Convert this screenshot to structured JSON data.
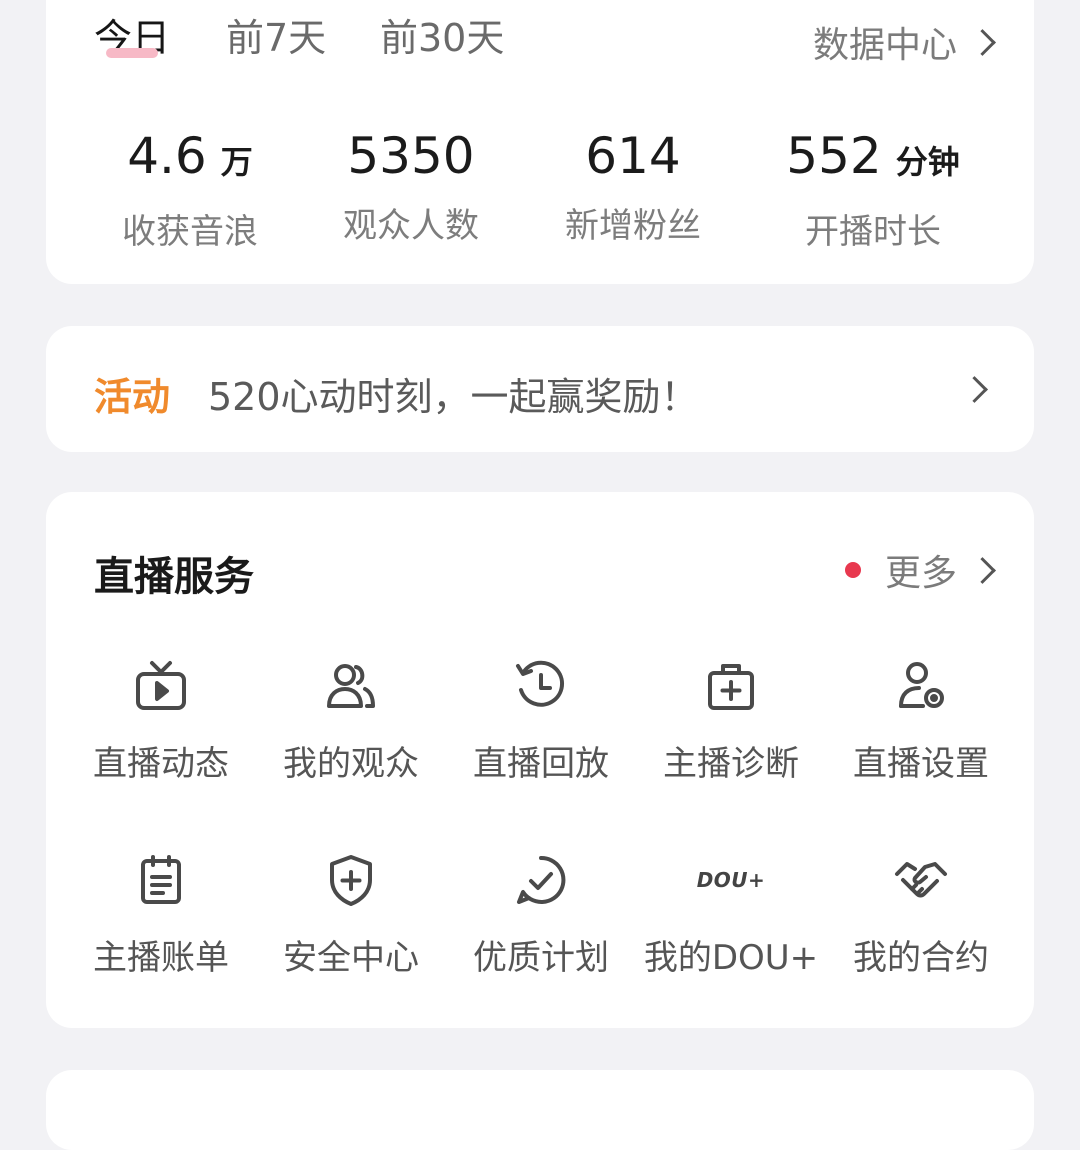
{
  "stats": {
    "tabs": [
      "今日",
      "前7天",
      "前30天"
    ],
    "data_center": "数据中心",
    "items": [
      {
        "value": "4.6",
        "unit": "万",
        "label": "收获音浪"
      },
      {
        "value": "5350",
        "unit": "",
        "label": "观众人数"
      },
      {
        "value": "614",
        "unit": "",
        "label": "新增粉丝"
      },
      {
        "value": "552",
        "unit": "分钟",
        "label": "开播时长"
      }
    ]
  },
  "activity": {
    "tag": "活动",
    "text": "520心动时刻，一起赢奖励！"
  },
  "services": {
    "title": "直播服务",
    "more": "更多",
    "items": [
      {
        "label": "直播动态",
        "icon": "tv-play-icon"
      },
      {
        "label": "我的观众",
        "icon": "audience-icon"
      },
      {
        "label": "直播回放",
        "icon": "history-clock-icon"
      },
      {
        "label": "主播诊断",
        "icon": "medical-kit-icon"
      },
      {
        "label": "直播设置",
        "icon": "user-settings-icon"
      },
      {
        "label": "主播账单",
        "icon": "bill-clipboard-icon"
      },
      {
        "label": "安全中心",
        "icon": "shield-plus-icon"
      },
      {
        "label": "优质计划",
        "icon": "check-circle-icon"
      },
      {
        "label": "我的DOU+",
        "icon": "dou-plus-icon"
      },
      {
        "label": "我的合约",
        "icon": "handshake-icon"
      }
    ]
  },
  "dou_logo_text": "DOU+",
  "colors": {
    "accent_orange": "#f08a2c",
    "notice_red": "#e8384f",
    "tab_underline": "#f7b9c6"
  }
}
